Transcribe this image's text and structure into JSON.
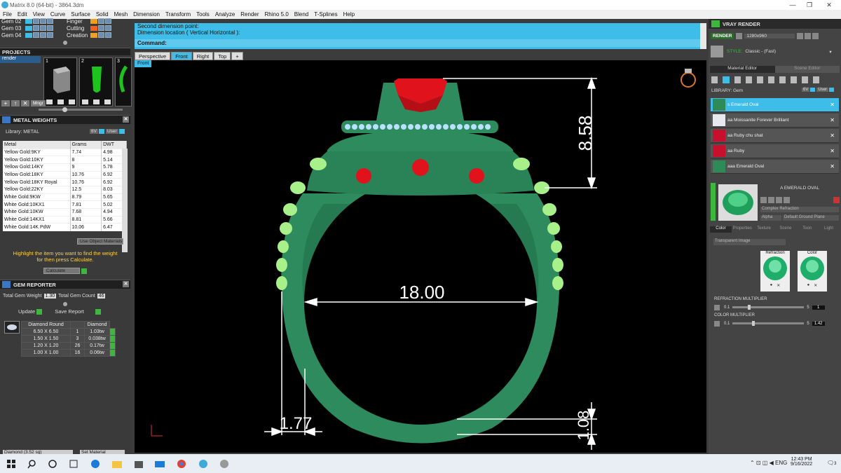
{
  "window": {
    "title": "Matrix 8.0 (64-bit) - 3864.3dm",
    "min": "—",
    "max": "❐",
    "close": "✕"
  },
  "menu": [
    "File",
    "Edit",
    "View",
    "Curve",
    "Surface",
    "Solid",
    "Mesh",
    "Dimension",
    "Transform",
    "Tools",
    "Analyze",
    "Render",
    "Rhino 5.0",
    "Blend",
    "T-Splines",
    "Help"
  ],
  "layers": {
    "left": [
      "Gem 02",
      "Gem 03",
      "Gem 04"
    ],
    "right": [
      "Finger",
      "Cutting",
      "Creation"
    ]
  },
  "projects": {
    "title": "PROJECTS",
    "item": "render",
    "thumbs": [
      "1",
      "2",
      "3"
    ],
    "mngr": "Mngr"
  },
  "metal_weights": {
    "title": "METAL WEIGHTS",
    "library_label": "Library: METAL",
    "lib_btn_1": "6V",
    "lib_btn_2": "User",
    "columns": [
      "Metal",
      "Grams",
      "DWT"
    ],
    "rows": [
      [
        "Yellow Gold:9KY",
        "7.74",
        "4.98"
      ],
      [
        "Yellow Gold:10KY",
        "8",
        "5.14"
      ],
      [
        "Yellow Gold:14KY",
        "9",
        "5.78"
      ],
      [
        "Yellow Gold:18KY",
        "10.76",
        "6.92"
      ],
      [
        "Yellow Gold:18KY Royal",
        "10.76",
        "6.92"
      ],
      [
        "Yellow Gold:22KY",
        "12.5",
        "8.03"
      ],
      [
        "White Gold:9KW",
        "8.79",
        "5.65"
      ],
      [
        "White Gold:10KX1",
        "7.81",
        "5.02"
      ],
      [
        "White Gold:10KW",
        "7.68",
        "4.94"
      ],
      [
        "White Gold:14KX1",
        "8.81",
        "5.66"
      ],
      [
        "White Gold:14K PdW",
        "10.06",
        "6.47"
      ]
    ],
    "use_object": "Use Object Materials",
    "hint_line1": "Highlight the item you want to find the weight",
    "hint_line2": "for then press Calculate.",
    "calculate": "Calculate"
  },
  "gem_reporter": {
    "title": "GEM REPORTER",
    "total_weight_label": "Total Gem Weight",
    "total_weight_value": "1.30",
    "total_count_label": "Total Gem Count",
    "total_count_value": "46",
    "update": "Update",
    "save_report": "Save Report",
    "columns": [
      "Diamond Round",
      "",
      "Diamond"
    ],
    "rows": [
      [
        "6.50 X 6.50",
        "1",
        "1.03tw"
      ],
      [
        "1.50 X 1.50",
        "3",
        "0.038tw"
      ],
      [
        "1.20 X 1.20",
        "26",
        "0.17tw"
      ],
      [
        "1.00 X 1.00",
        "16",
        "0.06tw"
      ]
    ],
    "footer_left": "Diamond   (3.52 sg)",
    "footer_right": "Set Material"
  },
  "command": {
    "line1": "Second dimension point:",
    "line2": "Dimension location ( Vertical  Horizontal ):",
    "label": "Command:"
  },
  "viewport_tabs": [
    "Perspective",
    "Front",
    "Right",
    "Top",
    "+"
  ],
  "active_tab": "Front",
  "viewport_label": "Front",
  "dimensions": {
    "height": "8.58",
    "width": "18.00",
    "shank": "1.77",
    "bottom": "1.08"
  },
  "vray": {
    "title": "VRAY RENDER",
    "render_btn": "RENDER",
    "resolution": "1280x960",
    "style_label": "STYLE:",
    "style_value": "Classic - (Fast)",
    "tabs": [
      "Material Editor",
      "Scene Editor"
    ],
    "library_label": "LIBRARY: Gem",
    "lib_btn_1": "6V",
    "lib_btn_2": "User",
    "materials": [
      "s Emerald Oval",
      "aa Moissanite Forever Brilliant",
      "aa Ruby chu shat",
      "aa Ruby",
      "aaa Emerald Oval"
    ],
    "selected_material": "A EMERALD OVAL",
    "complex": "Complex Refraction",
    "alpha": "Alpha",
    "ground": "Default Ground Plane",
    "subtabs": [
      "Color",
      "Properties",
      "Texture",
      "Scene",
      "Toon",
      "Light"
    ],
    "transparent": "Transparent Image",
    "refraction": "Refraction",
    "color": "Color",
    "refraction_mult_label": "REFRACTION MULTIPLIER",
    "refraction_mult_min": "0.1",
    "refraction_mult_max": "5",
    "refraction_mult_value": "1",
    "color_mult_label": "COLOR MULTIPLIER",
    "color_mult_min": "0.1",
    "color_mult_max": "5",
    "color_mult_value": "1.42"
  },
  "taskbar": {
    "time": "12:43 PM",
    "date": "9/16/2022",
    "notif": "3"
  },
  "colors": {
    "accent": "#3dbde8",
    "ring": "#2e8b5e",
    "ruby": "#e0121c",
    "highlight": "#a8f08a"
  }
}
